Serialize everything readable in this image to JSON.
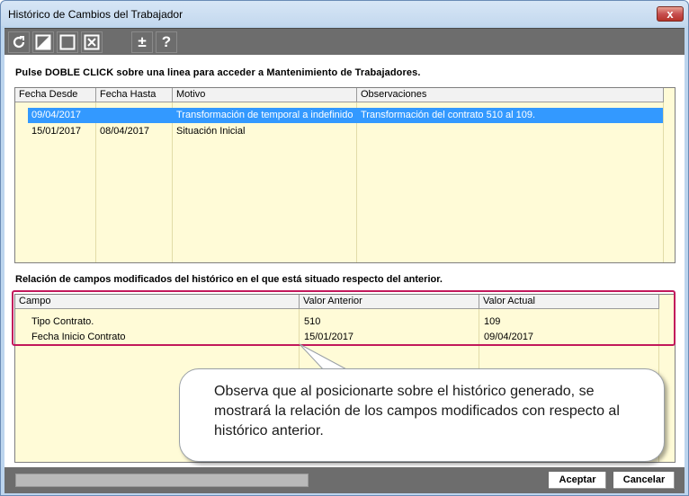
{
  "window": {
    "title": "Histórico de Cambios del Trabajador",
    "close_label": "x"
  },
  "toolbar": {
    "buttons": [
      {
        "name": "refresh-icon"
      },
      {
        "name": "half-square-icon"
      },
      {
        "name": "empty-square-icon"
      },
      {
        "name": "close-square-icon"
      },
      {
        "name": "plus-minus-icon",
        "label": "±"
      },
      {
        "name": "help-icon",
        "label": "?"
      }
    ]
  },
  "main": {
    "instruction": "Pulse DOBLE CLICK sobre una linea para acceder a Mantenimiento de Trabajadores.",
    "history_grid": {
      "columns": [
        "Fecha Desde",
        "Fecha Hasta",
        "Motivo",
        "Observaciones"
      ],
      "rows": [
        {
          "fecha_desde": "09/04/2017",
          "fecha_hasta": "",
          "motivo": "Transformación de temporal a indefinido",
          "observaciones": "Transformación del contrato 510 al 109.",
          "selected": true
        },
        {
          "fecha_desde": "15/01/2017",
          "fecha_hasta": "08/04/2017",
          "motivo": "Situación Inicial",
          "observaciones": "",
          "selected": false
        }
      ]
    },
    "fields_heading": "Relación de campos modificados del histórico en el que está situado respecto del anterior.",
    "fields_grid": {
      "columns": [
        "Campo",
        "Valor Anterior",
        "Valor Actual"
      ],
      "rows": [
        {
          "campo": "Tipo Contrato.",
          "valor_anterior": "510",
          "valor_actual": "109"
        },
        {
          "campo": "Fecha Inicio Contrato",
          "valor_anterior": "15/01/2017",
          "valor_actual": "09/04/2017"
        }
      ]
    }
  },
  "callout": {
    "text": "Observa que al posicionarte sobre el histórico generado, se mostrará la relación de los campos modificados con respecto al histórico anterior."
  },
  "footer": {
    "accept_label": "Aceptar",
    "cancel_label": "Cancelar"
  },
  "colors": {
    "grid_background": "#fffbd7",
    "selection": "#3399ff",
    "toolbar": "#6d6d6d",
    "highlight_border": "#c2185b"
  }
}
